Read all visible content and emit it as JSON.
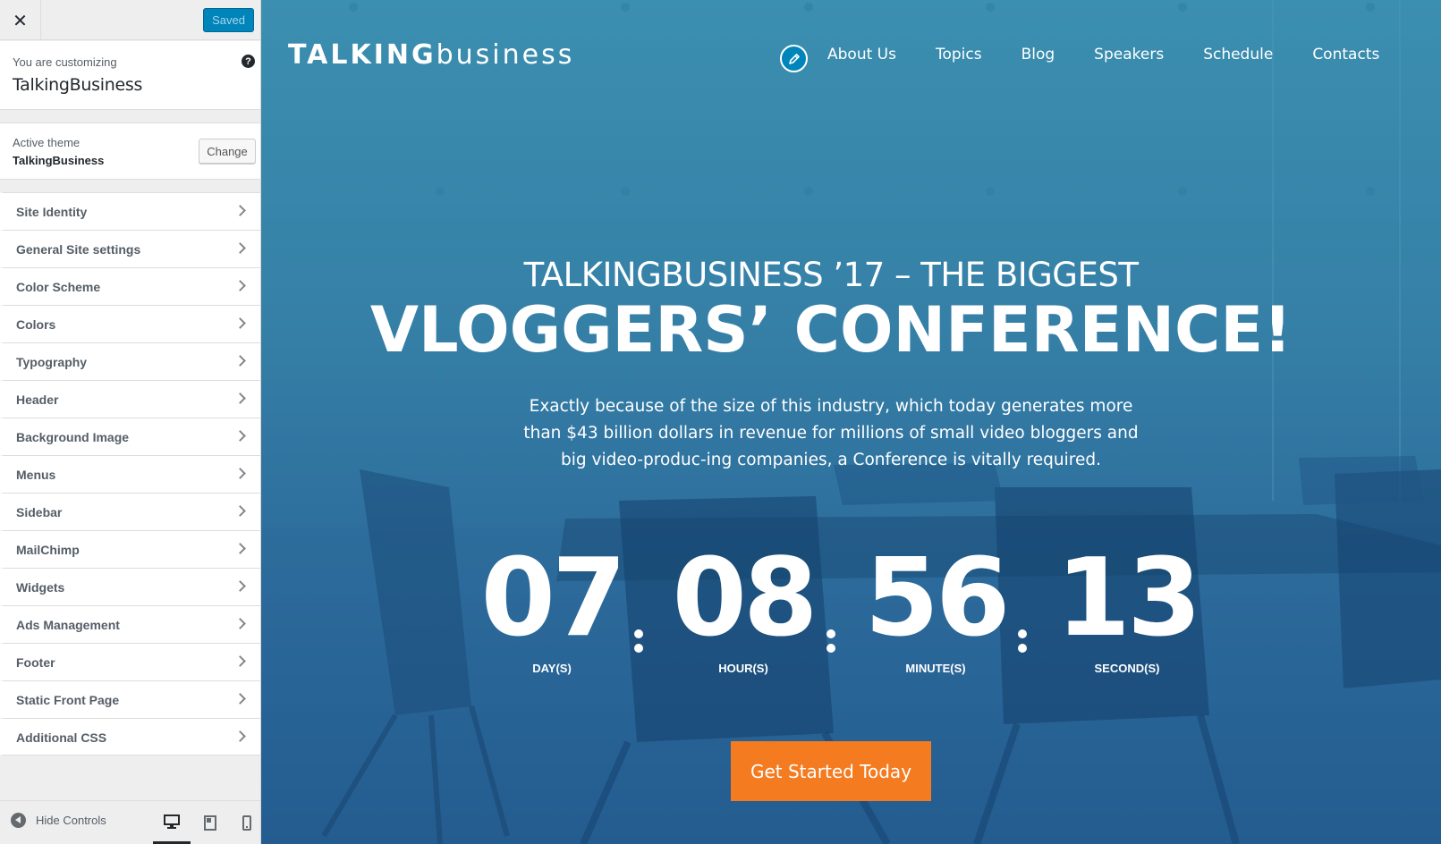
{
  "customizer": {
    "close_icon": "close-icon",
    "saved_label": "Saved",
    "customizing_label": "You are customizing",
    "site_name": "TalkingBusiness",
    "help_glyph": "?",
    "active_theme_label": "Active theme",
    "active_theme_name": "TalkingBusiness",
    "change_label": "Change",
    "sections": [
      {
        "label": "Site Identity"
      },
      {
        "label": "General Site settings"
      },
      {
        "label": "Color Scheme"
      },
      {
        "label": "Colors"
      },
      {
        "label": "Typography"
      },
      {
        "label": "Header"
      },
      {
        "label": "Background Image"
      },
      {
        "label": "Menus"
      },
      {
        "label": "Sidebar"
      },
      {
        "label": "MailChimp"
      },
      {
        "label": "Widgets"
      },
      {
        "label": "Ads Management"
      },
      {
        "label": "Footer"
      },
      {
        "label": "Static Front Page"
      },
      {
        "label": "Additional CSS"
      }
    ],
    "footer": {
      "hide_controls_label": "Hide Controls",
      "devices": [
        "desktop",
        "tablet",
        "mobile"
      ],
      "active_device": "desktop"
    },
    "colors": {
      "primary_button": "#0085ba",
      "panel_bg": "#eeeeee"
    }
  },
  "preview": {
    "logo_bold": "TALKING",
    "logo_light": "business",
    "nav": [
      "About Us",
      "Topics",
      "Blog",
      "Speakers",
      "Schedule",
      "Contacts"
    ],
    "hero_subtitle": "TALKINGBUSINESS ’17 – THE BIGGEST",
    "hero_title": "VLOGGERS’ CONFERENCE!",
    "hero_text": "Exactly because of the size of this industry, which today generates more than $43 billion dollars in revenue for millions of small video bloggers and big video-produc-ing companies, a Conference is vitally required.",
    "countdown": [
      {
        "value": "07",
        "label": "DAY(S)"
      },
      {
        "value": "08",
        "label": "HOUR(S)"
      },
      {
        "value": "56",
        "label": "MINUTE(S)"
      },
      {
        "value": "13",
        "label": "SECOND(S)"
      }
    ],
    "cta_label": "Get Started Today",
    "colors": {
      "cta": "#f47b20",
      "overlay_top": "#3b8fb0",
      "overlay_bottom": "#21558c"
    }
  }
}
